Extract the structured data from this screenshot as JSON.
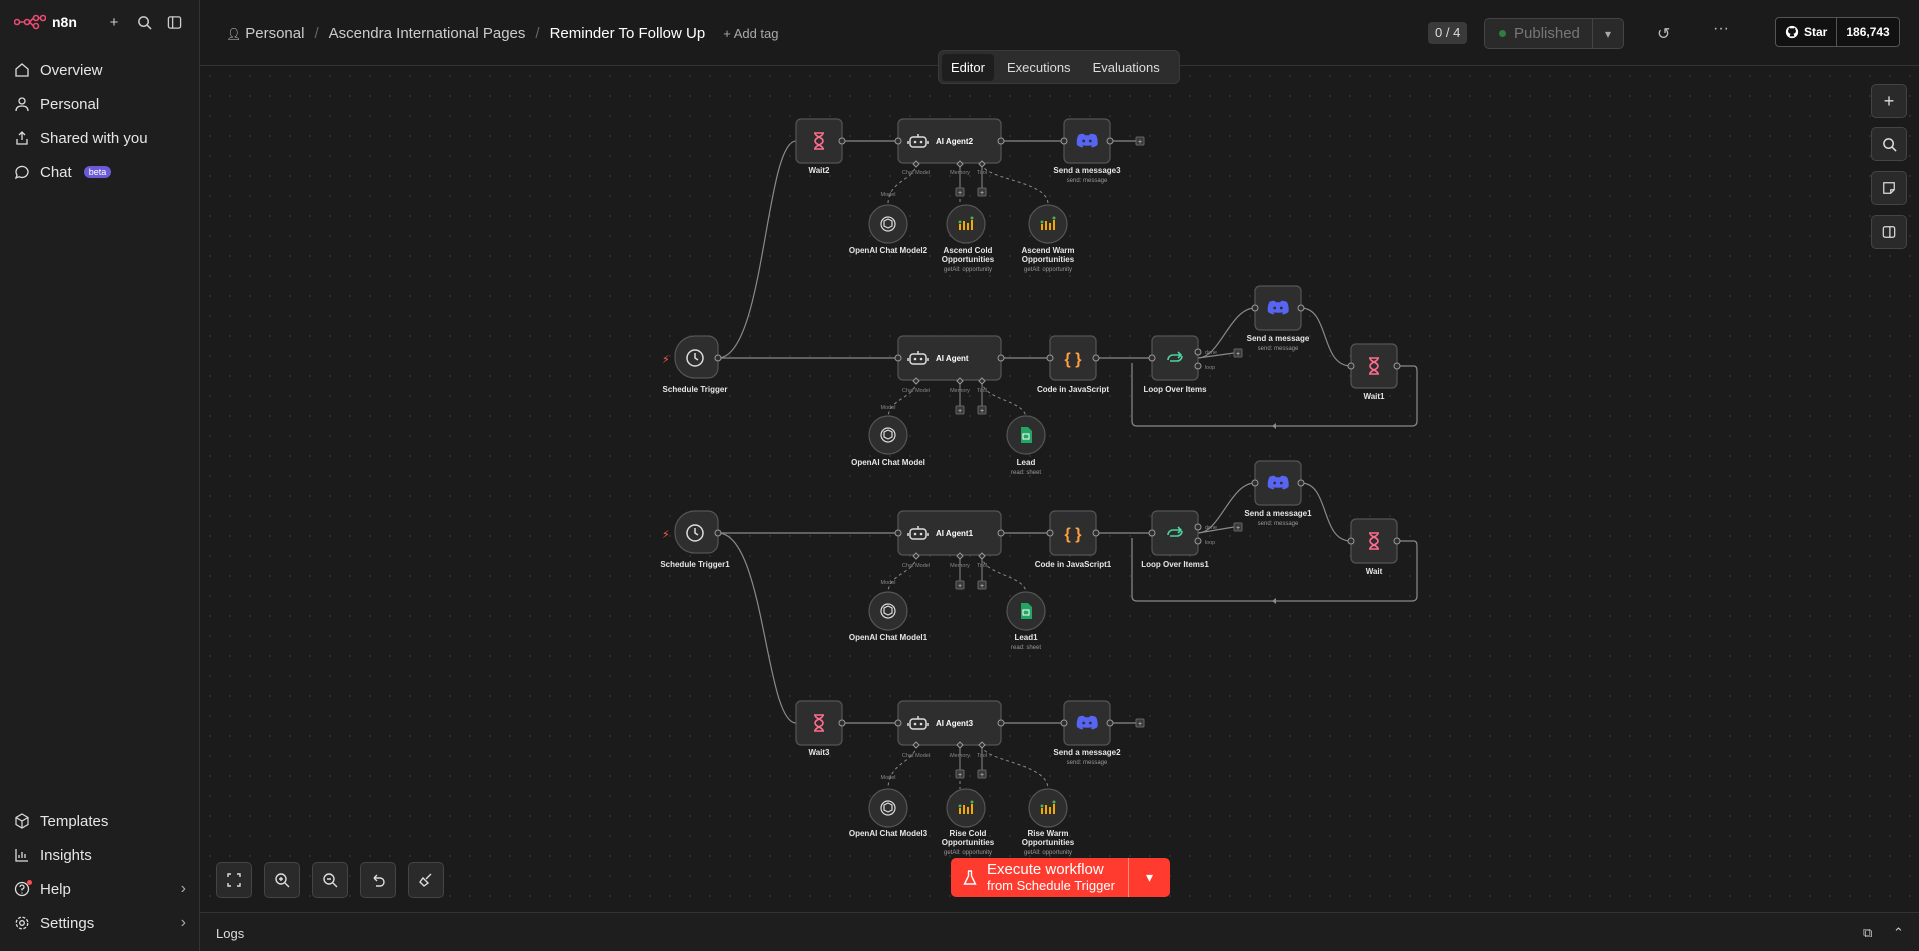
{
  "app": {
    "logo_text": "n8n"
  },
  "sidebar": {
    "nav": [
      {
        "label": "Overview",
        "icon": "home-icon"
      },
      {
        "label": "Personal",
        "icon": "user-icon"
      },
      {
        "label": "Shared with you",
        "icon": "share-icon"
      },
      {
        "label": "Chat",
        "icon": "chat-icon",
        "badge": "beta"
      }
    ],
    "bottom": [
      {
        "label": "Templates",
        "icon": "templates-icon"
      },
      {
        "label": "Insights",
        "icon": "insights-icon"
      },
      {
        "label": "Help",
        "icon": "help-icon"
      },
      {
        "label": "Settings",
        "icon": "gear-icon"
      }
    ]
  },
  "header": {
    "breadcrumb": [
      "Personal",
      "Ascendra International Pages"
    ],
    "workflow_name": "Reminder To Follow Up",
    "add_tag": "+ Add tag",
    "counter": "0 / 4",
    "publish_label": "Published",
    "github_star": "Star",
    "github_count": "186,743",
    "tabs": [
      "Editor",
      "Executions",
      "Evaluations"
    ],
    "active_tab": "Editor"
  },
  "canvas": {
    "nodes": {
      "wait2": "Wait2",
      "agent2": "AI Agent2",
      "msg3": "Send a message3",
      "msg3_sub": "send: message",
      "oai2": "OpenAI Chat Model2",
      "acold1": "Ascend Cold",
      "acold2": "Opportunities",
      "acold_sub": "getAll: opportunity",
      "awarm1": "Ascend Warm",
      "awarm2": "Opportunities",
      "awarm_sub": "getAll: opportunity",
      "st": "Schedule Trigger",
      "agent": "AI Agent",
      "code": "Code in JavaScript",
      "loop": "Loop Over Items",
      "msg": "Send a message",
      "msg_sub": "send: message",
      "wait1": "Wait1",
      "oai": "OpenAI Chat Model",
      "lead": "Lead",
      "lead_sub": "read: sheet",
      "st1": "Schedule Trigger1",
      "agent1": "AI Agent1",
      "code1": "Code in JavaScript1",
      "loop1": "Loop Over Items1",
      "msg1": "Send a message1",
      "msg1_sub": "send: message",
      "wait": "Wait",
      "oai1": "OpenAI Chat Model1",
      "lead1": "Lead1",
      "lead1_sub": "read: sheet",
      "wait3": "Wait3",
      "agent3": "AI Agent3",
      "msg2": "Send a message2",
      "msg2_sub": "send: message",
      "oai3": "OpenAI Chat Model3",
      "rcold1": "Rise Cold",
      "rcold2": "Opportunities",
      "rcold_sub": "getAll: opportunity",
      "rwarm1": "Rise Warm",
      "rwarm2": "Opportunities",
      "rwarm_sub": "getAll: opportunity"
    },
    "ports": {
      "chat_model": "Chat Model",
      "memory": "Memory",
      "tool": "Tool",
      "model": "Model",
      "done": "done",
      "loop": "loop"
    }
  },
  "execute": {
    "label": "Execute workflow",
    "sub": "from Schedule Trigger"
  },
  "logs": {
    "label": "Logs"
  },
  "colors": {
    "accent": "#ff3b30",
    "discord": "#5865f2",
    "wait": "#ff6d8d",
    "code": "#ff9f43",
    "loop": "#4cd3a0",
    "sheet": "#22a565"
  }
}
